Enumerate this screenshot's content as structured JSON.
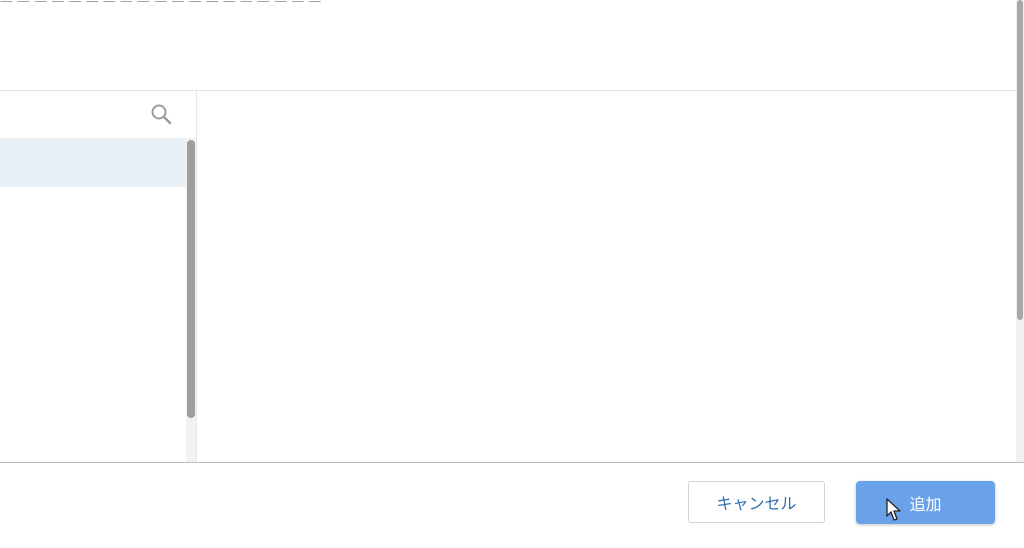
{
  "top": {
    "faded_text": "— — — — — —   — — — — — —  —   — — — — — —"
  },
  "search": {
    "placeholder": "",
    "value": ""
  },
  "footer": {
    "cancel_label": "キャンセル",
    "add_label": "追加"
  },
  "icons": {
    "search": "search-icon",
    "cursor": "mouse-pointer-icon"
  },
  "colors": {
    "selected_row": "#e9f1f7",
    "add_button": "#6aa2ea",
    "cancel_text": "#2d6fb3"
  }
}
